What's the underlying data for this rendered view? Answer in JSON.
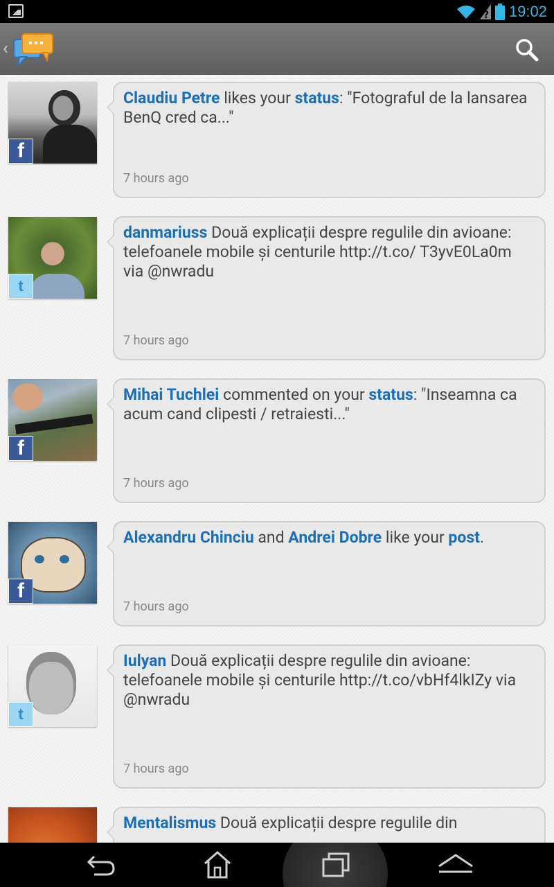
{
  "status_bar": {
    "time": "19:02"
  },
  "feed": [
    {
      "network": "facebook",
      "parts": [
        {
          "t": "Claudiu Petre",
          "link": true
        },
        {
          "t": " likes your ",
          "link": false
        },
        {
          "t": "status",
          "link": true
        },
        {
          "t": ": \"Fotograful de la lansarea BenQ cred ca...\"",
          "link": false
        }
      ],
      "time": "7 hours ago"
    },
    {
      "network": "twitter",
      "parts": [
        {
          "t": "danmariuss",
          "link": true
        },
        {
          "t": "  Două explicații despre regulile din avioane: telefoanele mobile și centurile http://t.co/ T3yvE0La0m via @nwradu",
          "link": false
        }
      ],
      "time": "7 hours ago"
    },
    {
      "network": "facebook",
      "parts": [
        {
          "t": "Mihai Tuchlei",
          "link": true
        },
        {
          "t": " commented on your ",
          "link": false
        },
        {
          "t": "status",
          "link": true
        },
        {
          "t": ": \"Inseamna ca acum cand clipesti / retraiesti...\"",
          "link": false
        }
      ],
      "time": "7 hours ago"
    },
    {
      "network": "facebook",
      "parts": [
        {
          "t": "Alexandru Chinciu",
          "link": true
        },
        {
          "t": " and ",
          "link": false
        },
        {
          "t": "Andrei Dobre",
          "link": true
        },
        {
          "t": " like your ",
          "link": false
        },
        {
          "t": "post",
          "link": true
        },
        {
          "t": ".",
          "link": false
        }
      ],
      "time": "7 hours ago"
    },
    {
      "network": "twitter",
      "parts": [
        {
          "t": "Iulyan",
          "link": true
        },
        {
          "t": "  Două explicații despre regulile din avioane: telefoanele mobile și centurile http://t.co/vbHf4lkIZy via @nwradu",
          "link": false
        }
      ],
      "time": "7 hours ago"
    },
    {
      "network": "twitter",
      "parts": [
        {
          "t": "Mentalismus",
          "link": true
        },
        {
          "t": "  Două explicații despre regulile din",
          "link": false
        }
      ],
      "time": ""
    }
  ],
  "network_icons": {
    "facebook": "f",
    "twitter": "t"
  },
  "colors": {
    "link": "#1c6eb5",
    "accent": "#33b5e5",
    "facebook": "#3b5998",
    "twitter": "#9bd6f2"
  }
}
